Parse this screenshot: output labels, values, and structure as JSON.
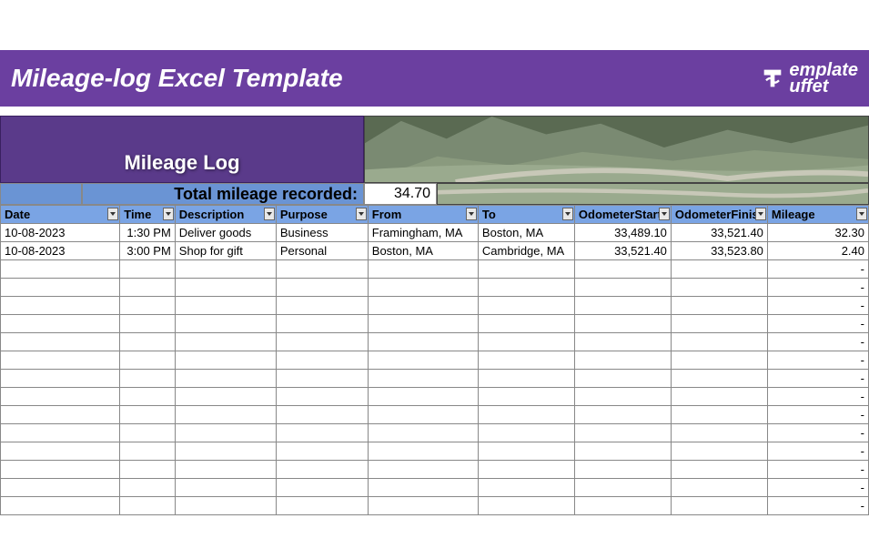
{
  "title": "Mileage-log Excel Template",
  "logo": {
    "text1": "emplate",
    "text2": "uffet"
  },
  "banner": {
    "heading": "Mileage Log"
  },
  "summary": {
    "label": "Total mileage recorded:",
    "value": "34.70"
  },
  "columns": [
    {
      "key": "date",
      "label": "Date"
    },
    {
      "key": "time",
      "label": "Time"
    },
    {
      "key": "desc",
      "label": "Description"
    },
    {
      "key": "purpose",
      "label": "Purpose"
    },
    {
      "key": "from",
      "label": "From"
    },
    {
      "key": "to",
      "label": "To"
    },
    {
      "key": "ostart",
      "label": "OdometerStart"
    },
    {
      "key": "ofinish",
      "label": "OdometerFinish"
    },
    {
      "key": "mileage",
      "label": "Mileage"
    }
  ],
  "rows": [
    {
      "date": "10-08-2023",
      "time": "1:30 PM",
      "desc": "Deliver goods",
      "purpose": "Business",
      "from": "Framingham, MA",
      "to": "Boston, MA",
      "ostart": "33,489.10",
      "ofinish": "33,521.40",
      "mileage": "32.30"
    },
    {
      "date": "10-08-2023",
      "time": "3:00 PM",
      "desc": "Shop for gift",
      "purpose": "Personal",
      "from": "Boston, MA",
      "to": "Cambridge, MA",
      "ostart": "33,521.40",
      "ofinish": "33,523.80",
      "mileage": "2.40"
    }
  ],
  "empty_rows": 14,
  "empty_mileage": "-",
  "chart_data": {
    "type": "table",
    "title": "Mileage Log",
    "columns": [
      "Date",
      "Time",
      "Description",
      "Purpose",
      "From",
      "To",
      "OdometerStart",
      "OdometerFinish",
      "Mileage"
    ],
    "rows": [
      [
        "10-08-2023",
        "1:30 PM",
        "Deliver goods",
        "Business",
        "Framingham, MA",
        "Boston, MA",
        33489.1,
        33521.4,
        32.3
      ],
      [
        "10-08-2023",
        "3:00 PM",
        "Shop for gift",
        "Personal",
        "Boston, MA",
        "Cambridge, MA",
        33521.4,
        33523.8,
        2.4
      ]
    ],
    "summary": {
      "label": "Total mileage recorded:",
      "value": 34.7
    }
  }
}
